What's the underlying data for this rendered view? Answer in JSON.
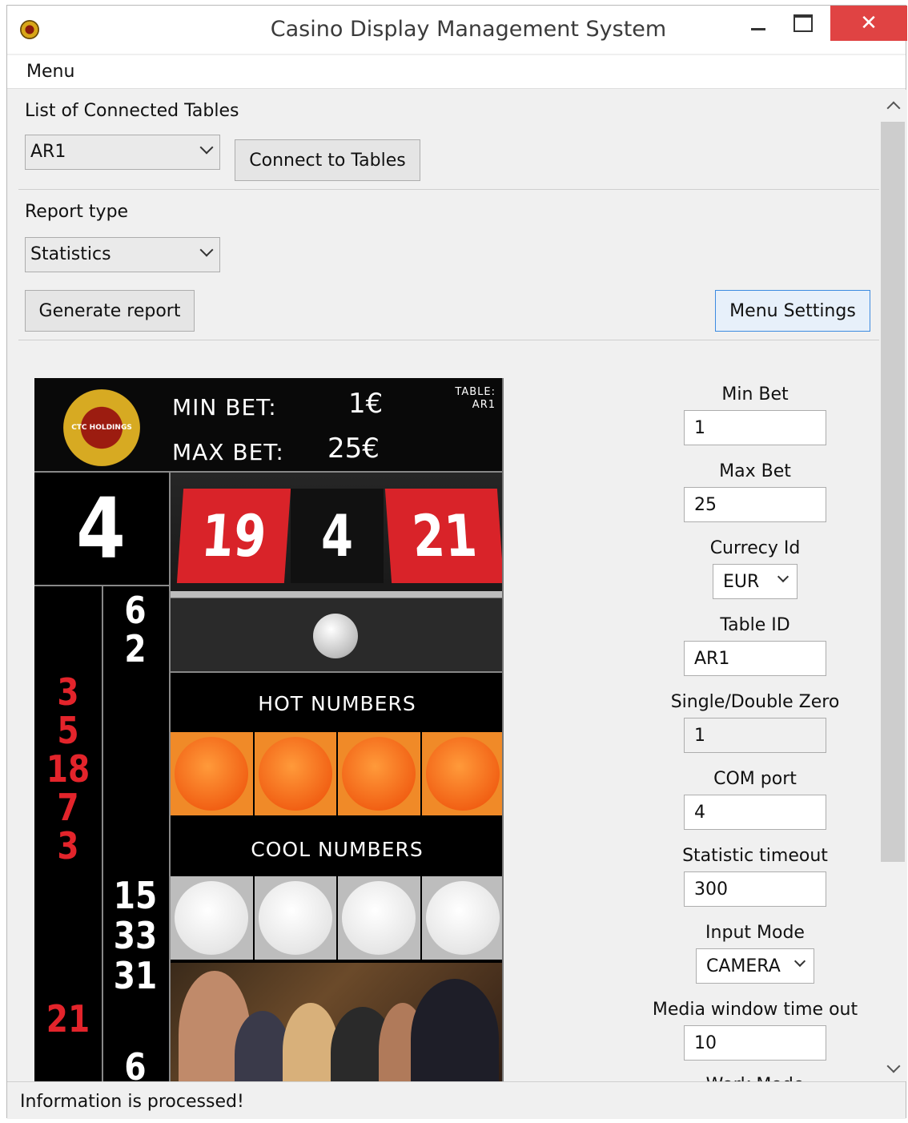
{
  "window": {
    "title": "Casino Display Management System"
  },
  "menubar": {
    "menu_label": "Menu"
  },
  "tables": {
    "section_label": "List of Connected Tables",
    "selected": "AR1",
    "connect_button": "Connect to Tables"
  },
  "report": {
    "section_label": "Report type",
    "selected": "Statistics",
    "generate_button": "Generate report",
    "menu_settings_button": "Menu Settings"
  },
  "preview": {
    "logo_text": "CTC HOLDINGS",
    "min_bet_label": "MIN BET:",
    "min_bet_value": "1€",
    "max_bet_label": "MAX BET:",
    "max_bet_value": "25€",
    "table_label": "TABLE:",
    "table_value": "AR1",
    "last_number": "4",
    "wheel_numbers": [
      "19",
      "4",
      "21"
    ],
    "history_black": [
      "6",
      "2",
      "15",
      "33",
      "31",
      "6"
    ],
    "history_red": [
      "3",
      "5",
      "18",
      "7",
      "3",
      "21"
    ],
    "hot_title": "HOT NUMBERS",
    "cool_title": "COOL NUMBERS"
  },
  "settings": {
    "min_bet": {
      "label": "Min Bet",
      "value": "1"
    },
    "max_bet": {
      "label": "Max Bet",
      "value": "25"
    },
    "currency": {
      "label": "Currecy Id",
      "value": "EUR"
    },
    "table_id": {
      "label": "Table ID",
      "value": "AR1"
    },
    "zero": {
      "label": "Single/Double Zero",
      "value": "1"
    },
    "com_port": {
      "label": "COM port",
      "value": "4"
    },
    "stat_timeout": {
      "label": "Statistic timeout",
      "value": "300"
    },
    "input_mode": {
      "label": "Input Mode",
      "value": "CAMERA"
    },
    "media_timeout": {
      "label": "Media window time out",
      "value": "10"
    },
    "work_mode": {
      "label": "Work Mode"
    }
  },
  "status": {
    "message": "Information is processed!"
  },
  "colors": {
    "close_button": "#e04343",
    "red_number": "#e3242b",
    "hot_tile": "#f08a28",
    "focus_border": "#3c8be0"
  }
}
